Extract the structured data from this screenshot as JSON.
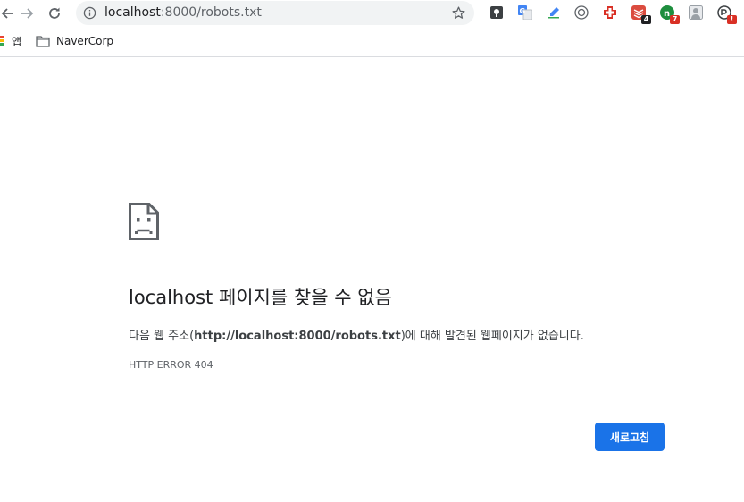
{
  "browser": {
    "url_host": "localhost",
    "url_path": ":8000/robots.txt",
    "extensions": [
      {
        "name": "keep-icon",
        "badge": ""
      },
      {
        "name": "translate-icon",
        "badge": ""
      },
      {
        "name": "pen-icon",
        "badge": ""
      },
      {
        "name": "pocket-icon",
        "badge": ""
      },
      {
        "name": "health-cross-icon",
        "badge": ""
      },
      {
        "name": "todoist-icon",
        "badge": "4"
      },
      {
        "name": "green-ext-icon",
        "badge": "7"
      },
      {
        "name": "profile-ext-icon",
        "badge": ""
      },
      {
        "name": "alert-ext-icon",
        "badge": "!"
      }
    ]
  },
  "bookmarks": {
    "apps_label": "앱",
    "folder_label": "NaverCorp"
  },
  "error_page": {
    "host": "localhost",
    "headline_suffix": " 페이지를 찾을 수 없음",
    "desc_prefix": "다음 웹 주소(",
    "desc_url": "http://localhost:8000/robots.txt",
    "desc_suffix": ")에 대해 발견된 웹페이지가 없습니다.",
    "error_code": "HTTP ERROR 404",
    "reload_label": "새로고침"
  },
  "colors": {
    "accent": "#1a73e8",
    "badge_dark": "#202124",
    "badge_red": "#d93025"
  }
}
